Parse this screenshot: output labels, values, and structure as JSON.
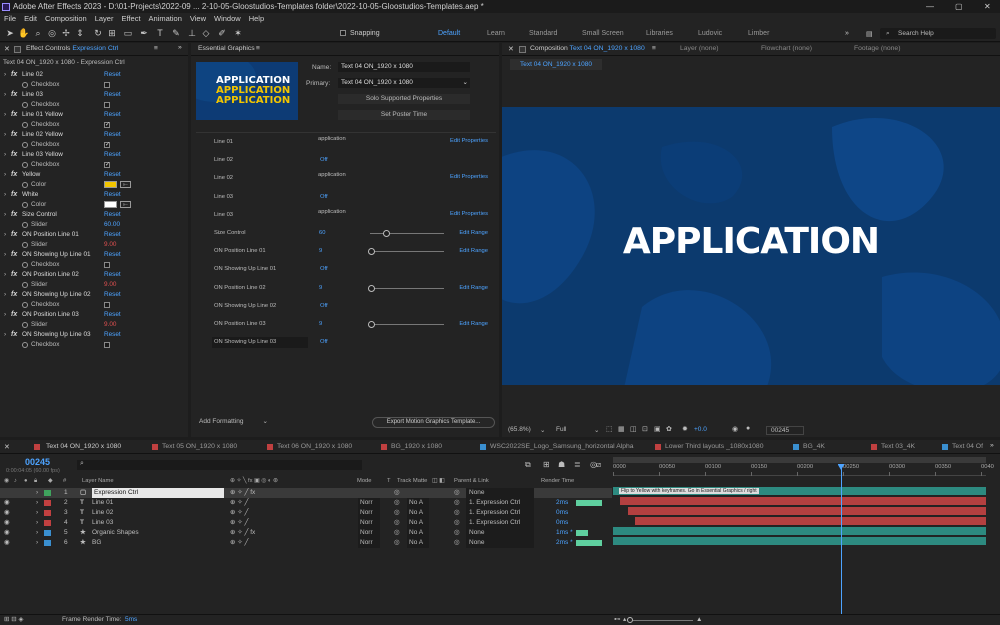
{
  "app": {
    "title": "Adobe After Effects 2023 - D:\\01-Projects\\2022-09 ... 2-10-05-Gloostudios-Templates folder\\2022-10-05-Gloostudios-Templates.aep *",
    "minimize": "—",
    "maximize": "▢",
    "close": "✕"
  },
  "menu": [
    "File",
    "Edit",
    "Composition",
    "Layer",
    "Effect",
    "Animation",
    "View",
    "Window",
    "Help"
  ],
  "toolbar": {
    "snapping": "Snapping",
    "workspaces": [
      "Default",
      "Learn",
      "Standard",
      "Small Screen",
      "Libraries",
      "Ludovic",
      "Limber"
    ],
    "search_placeholder": "Search Help"
  },
  "effect_controls": {
    "tab": "Effect Controls",
    "tab_target": "Expression Ctrl",
    "header": "Text 04 ON_1920 x 1080 - Expression Ctrl",
    "rows": [
      {
        "kind": "fx",
        "label": "Line 02",
        "reset": "Reset"
      },
      {
        "kind": "prop",
        "label": "Checkbox",
        "control": "check",
        "checked": false
      },
      {
        "kind": "fx",
        "label": "Line 03",
        "reset": "Reset"
      },
      {
        "kind": "prop",
        "label": "Checkbox",
        "control": "check",
        "checked": false
      },
      {
        "kind": "fx",
        "label": "Line 01 Yellow",
        "reset": "Reset"
      },
      {
        "kind": "prop",
        "label": "Checkbox",
        "control": "check",
        "checked": true
      },
      {
        "kind": "fx",
        "label": "Line 02 Yellow",
        "reset": "Reset"
      },
      {
        "kind": "prop",
        "label": "Checkbox",
        "control": "check",
        "checked": true
      },
      {
        "kind": "fx",
        "label": "Line 03 Yellow",
        "reset": "Reset"
      },
      {
        "kind": "prop",
        "label": "Checkbox",
        "control": "check",
        "checked": true
      },
      {
        "kind": "fx",
        "label": "Yellow",
        "reset": "Reset"
      },
      {
        "kind": "prop",
        "label": "Color",
        "control": "color",
        "color": "#f2c500"
      },
      {
        "kind": "fx",
        "label": "White",
        "reset": "Reset"
      },
      {
        "kind": "prop",
        "label": "Color",
        "control": "color",
        "color": "#ffffff"
      },
      {
        "kind": "fx",
        "label": "Size Control",
        "reset": "Reset"
      },
      {
        "kind": "prop",
        "label": "Slider",
        "control": "value",
        "value": "60.00",
        "value_color": "#4da3ff"
      },
      {
        "kind": "fx",
        "label": "ON Position Line 01",
        "reset": "Reset"
      },
      {
        "kind": "prop",
        "label": "Slider",
        "control": "value",
        "value": "9.00",
        "value_color": "#e05050"
      },
      {
        "kind": "fx",
        "label": "ON Showing Up Line 01",
        "reset": "Reset"
      },
      {
        "kind": "prop",
        "label": "Checkbox",
        "control": "check",
        "checked": false
      },
      {
        "kind": "fx",
        "label": "ON Position Line 02",
        "reset": "Reset"
      },
      {
        "kind": "prop",
        "label": "Slider",
        "control": "value",
        "value": "9.00",
        "value_color": "#e05050"
      },
      {
        "kind": "fx",
        "label": "ON Showing Up Line 02",
        "reset": "Reset"
      },
      {
        "kind": "prop",
        "label": "Checkbox",
        "control": "check",
        "checked": false
      },
      {
        "kind": "fx",
        "label": "ON Position Line 03",
        "reset": "Reset"
      },
      {
        "kind": "prop",
        "label": "Slider",
        "control": "value",
        "value": "9.00",
        "value_color": "#e05050"
      },
      {
        "kind": "fx",
        "label": "ON Showing Up Line 03",
        "reset": "Reset"
      },
      {
        "kind": "prop",
        "label": "Checkbox",
        "control": "check",
        "checked": false
      }
    ]
  },
  "essential_graphics": {
    "tab": "Essential Graphics",
    "thumb_text": [
      "APPLICATION",
      "APPLICATION",
      "APPLICATION"
    ],
    "name_label": "Name:",
    "name_value": "Text 04 ON_1920 x 1080",
    "primary_label": "Primary:",
    "primary_value": "Text 04 ON_1920 x 1080",
    "solo_btn": "Solo Supported Properties",
    "poster_btn": "Set Poster Time",
    "rows": [
      {
        "label": "Line 01",
        "value": "application",
        "value_type": "text",
        "action": "Edit Properties"
      },
      {
        "label": "Line 02",
        "value": "Off",
        "value_type": "link",
        "action": ""
      },
      {
        "label": "Line 02",
        "value": "application",
        "value_type": "text",
        "action": "Edit Properties"
      },
      {
        "label": "Line 03",
        "value": "Off",
        "value_type": "link",
        "action": ""
      },
      {
        "label": "Line 03",
        "value": "application",
        "value_type": "text",
        "action": "Edit Properties"
      },
      {
        "label": "Size Control",
        "value": "60",
        "value_type": "slider",
        "slider": 0.2,
        "action": "Edit Range"
      },
      {
        "label": "ON Position Line 01",
        "value": "9",
        "value_type": "slider",
        "slider": 0.0,
        "action": "Edit Range"
      },
      {
        "label": "ON Showing Up Line 01",
        "value": "Off",
        "value_type": "link",
        "action": ""
      },
      {
        "label": "ON Position Line 02",
        "value": "9",
        "value_type": "slider",
        "slider": 0.0,
        "action": "Edit Range"
      },
      {
        "label": "ON Showing Up Line 02",
        "value": "Off",
        "value_type": "link",
        "action": ""
      },
      {
        "label": "ON Position Line 03",
        "value": "9",
        "value_type": "slider",
        "slider": 0.0,
        "action": "Edit Range"
      },
      {
        "label": "ON Showing Up Line 03",
        "value": "Off",
        "value_type": "link",
        "action": ""
      }
    ],
    "add_formatting": "Add Formatting",
    "export_btn": "Export Motion Graphics Template..."
  },
  "composition": {
    "tab_prefix": "Composition",
    "tab_name": "Text 04 ON_1920 x 1080",
    "other_tabs": [
      "Layer (none)",
      "Flowchart (none)",
      "Footage (none)"
    ],
    "subtab": "Text 04 ON_1920 x 1080",
    "headline": "APPLICATION",
    "zoom": "(65.8%)",
    "resolution": "Full",
    "exposure": "+0.0",
    "timecode": "00245"
  },
  "timeline": {
    "tabs": [
      {
        "label": "Text 04 ON_1920 x 1080",
        "color": "#c04040"
      },
      {
        "label": "Text 05 ON_1920 x 1080",
        "color": "#c04040"
      },
      {
        "label": "Text 06 ON_1920 x 1080",
        "color": "#c04040"
      },
      {
        "label": "BG_1920 x 1080",
        "color": "#c04040"
      },
      {
        "label": "WSC2022SE_Logo_Samsung_horizontal Alpha",
        "color": "#3a8fd0"
      },
      {
        "label": "Lower Third layouts _1080x1080",
        "color": "#c04040"
      },
      {
        "label": "BG_4K",
        "color": "#3a8fd0"
      },
      {
        "label": "Text 03_4K",
        "color": "#c04040"
      },
      {
        "label": "Text 04 Of",
        "color": "#3a8fd0"
      }
    ],
    "current_time": "00245",
    "time_sub": "0:00:04:05 (60.00 fps)",
    "col_headers": {
      "num": "#",
      "name": "Layer Name",
      "mode": "Mode",
      "t": "T",
      "trkmat": "Track Matte",
      "parent": "Parent & Link",
      "render": "Render Time"
    },
    "ruler": [
      "0000",
      "00050",
      "00100",
      "00150",
      "00200",
      "00250",
      "00300",
      "00350",
      "0040"
    ],
    "layers": [
      {
        "num": "1",
        "name": "Expression Ctrl",
        "type": "null",
        "label": "#3fa35d",
        "mode": "",
        "trk": "",
        "parent": "None",
        "render": "",
        "selected": true,
        "bar_color": "#2d8a80",
        "bar_text": "Flip to Yellow with keyframes. Go in Essential Graphics / right",
        "bar_start": 0.0,
        "fx": true
      },
      {
        "num": "2",
        "name": "Line 01",
        "type": "T",
        "label": "#c04040",
        "mode": "Norr",
        "trk": "No A",
        "parent": "1. Expression Ctrl",
        "render": "2ms",
        "render_bar": 0.55,
        "bar_color": "#b44040",
        "bar_text": "",
        "bar_start": 0.02,
        "fx": false
      },
      {
        "num": "3",
        "name": "Line 02",
        "type": "T",
        "label": "#c04040",
        "mode": "Norr",
        "trk": "No A",
        "parent": "1. Expression Ctrl",
        "render": "0ms",
        "render_bar": 0,
        "bar_color": "#b44040",
        "bar_text": "",
        "bar_start": 0.04,
        "fx": false
      },
      {
        "num": "4",
        "name": "Line 03",
        "type": "T",
        "label": "#c04040",
        "mode": "Norr",
        "trk": "No A",
        "parent": "1. Expression Ctrl",
        "render": "0ms",
        "render_bar": 0,
        "bar_color": "#b44040",
        "bar_text": "",
        "bar_start": 0.06,
        "fx": false
      },
      {
        "num": "5",
        "name": "Organic Shapes",
        "type": "★",
        "label": "#3a8fd0",
        "mode": "Norr",
        "trk": "No A",
        "parent": "None",
        "render": "1ms *",
        "render_bar": 0.25,
        "bar_color": "#2d8a80",
        "bar_text": "",
        "bar_start": 0.0,
        "fx": true
      },
      {
        "num": "6",
        "name": "BG",
        "type": "★",
        "label": "#3a8fd0",
        "mode": "Norr",
        "trk": "No A",
        "parent": "None",
        "render": "2ms *",
        "render_bar": 0.55,
        "bar_color": "#2d8a80",
        "bar_text": "",
        "bar_start": 0.0,
        "fx": false
      }
    ],
    "playhead": 0.61,
    "footer": "Frame Render Time:",
    "footer_value": "5ms"
  }
}
